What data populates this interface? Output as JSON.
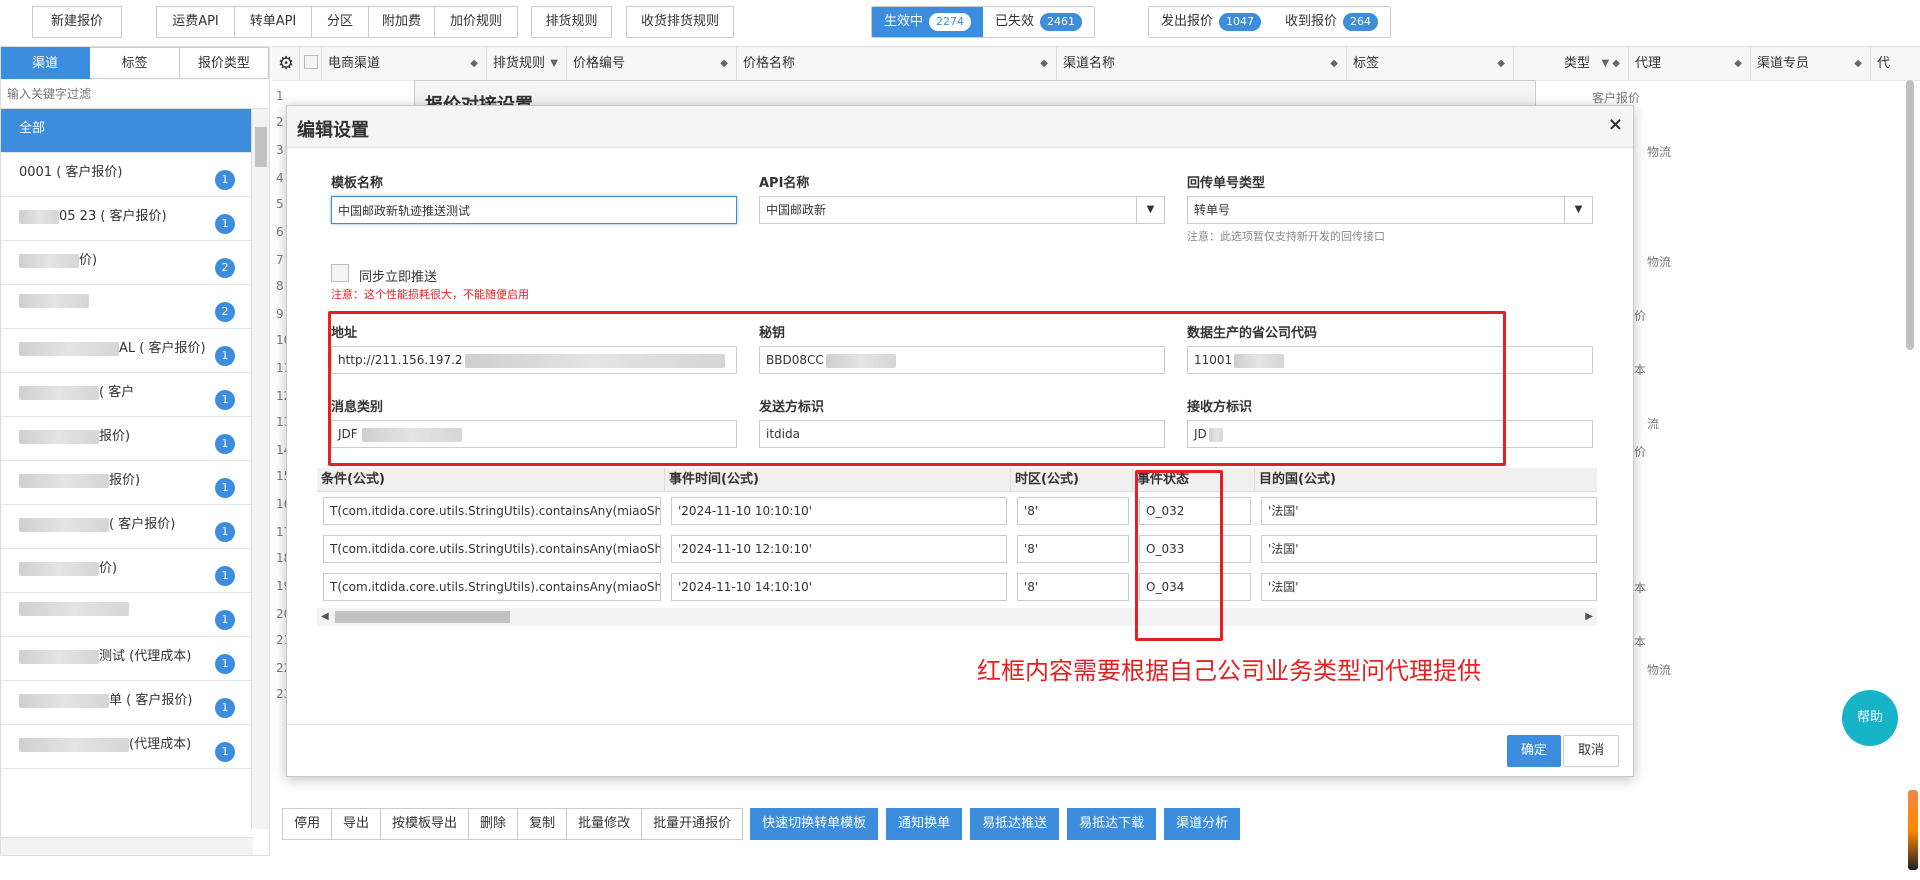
{
  "toolbar": {
    "new_quote": "新建报价",
    "tabs": [
      "运费API",
      "转单API",
      "分区",
      "附加费",
      "加价规则"
    ],
    "dispatch_rules": "排货规则",
    "receive_rules": "收货排货规则",
    "status_seg": [
      {
        "label": "生效中",
        "count": "2274"
      },
      {
        "label": "已失效",
        "count": "2461"
      }
    ],
    "quote_seg": [
      {
        "label": "发出报价",
        "count": "1047"
      },
      {
        "label": "收到报价",
        "count": "264"
      }
    ]
  },
  "left": {
    "tabs": [
      "渠道",
      "标签",
      "报价类型"
    ],
    "filter_placeholder": "输入关键字过滤",
    "items": [
      {
        "label": "全部",
        "count": ""
      },
      {
        "label": "0001 ( 客户报价)",
        "count": "1"
      },
      {
        "label": "05    23 ( 客户报价)",
        "count": "1"
      },
      {
        "label": "价)",
        "count": "2"
      },
      {
        "label": "",
        "count": "2"
      },
      {
        "label": "AL  ( 客户报价)",
        "count": "1"
      },
      {
        "label": "( 客户",
        "count": "1"
      },
      {
        "label": "报价)",
        "count": "1"
      },
      {
        "label": "报价)",
        "count": "1"
      },
      {
        "label": "( 客户报价)",
        "count": "1"
      },
      {
        "label": "价)",
        "count": "1"
      },
      {
        "label": "",
        "count": "1"
      },
      {
        "label": "测试 (代理成本)",
        "count": "1"
      },
      {
        "label": "单 ( 客户报价)",
        "count": "1"
      },
      {
        "label": "(代理成本)",
        "count": "1"
      }
    ]
  },
  "grid": {
    "columns": [
      "电商渠道",
      "排货规则",
      "价格编号",
      "价格名称",
      "渠道名称",
      "标签",
      "类型",
      "代理",
      "渠道专员",
      "代"
    ],
    "rows": [
      "1",
      "2",
      "3",
      "4",
      "5",
      "6",
      "7",
      "8",
      "9",
      "10",
      "11",
      "12",
      "13",
      "14",
      "15",
      "16",
      "17",
      "18",
      "19",
      "20",
      "21",
      "22",
      "23"
    ],
    "right_texts": [
      "客户报价",
      "物流",
      "物流",
      "价",
      "本",
      "流",
      "价",
      "本",
      "本",
      "物流"
    ]
  },
  "bg_dialog": {
    "title": "报价对接设置"
  },
  "dialog": {
    "title": "编辑设置",
    "template_name_label": "模板名称",
    "template_name_value": "中国邮政新轨迹推送测试",
    "api_name_label": "API名称",
    "api_name_value": "中国邮政新",
    "return_type_label": "回传单号类型",
    "return_type_value": "转单号",
    "return_type_note": "注意：此选项暂仅支持新开发的回传接口",
    "sync_label": "同步立即推送",
    "sync_note": "注意：这个性能损耗很大，不能随便启用",
    "address_label": "地址",
    "address_value": "http://211.156.197.2",
    "secret_label": "秘钥",
    "secret_value": "BBD08CC",
    "province_code_label": "数据生产的省公司代码",
    "province_code_value": "11001",
    "msg_type_label": "消息类别",
    "msg_type_value": "JDF",
    "sender_label": "发送方标识",
    "sender_value": "itdida",
    "receiver_label": "接收方标识",
    "receiver_value": "JD",
    "table_headers": [
      "条件(公式)",
      "事件时间(公式)",
      "时区(公式)",
      "事件状态",
      "目的国(公式)"
    ],
    "table_rows": [
      {
        "cond": "T(com.itdida.core.utils.StringUtils).containsAny(miaoSh",
        "time": "'2024-11-10 10:10:10'",
        "tz": "'8'",
        "status": "O_032",
        "dest": "'法国'"
      },
      {
        "cond": "T(com.itdida.core.utils.StringUtils).containsAny(miaoSh",
        "time": "'2024-11-10 12:10:10'",
        "tz": "'8'",
        "status": "O_033",
        "dest": "'法国'"
      },
      {
        "cond": "T(com.itdida.core.utils.StringUtils).containsAny(miaoSh",
        "time": "'2024-11-10 14:10:10'",
        "tz": "'8'",
        "status": "O_034",
        "dest": "'法国'"
      }
    ],
    "annotation": "红框内容需要根据自己公司业务类型问代理提供",
    "ok": "确定",
    "cancel": "取消",
    "close": "×"
  },
  "bottom": {
    "plain": [
      "停用",
      "导出",
      "按模板导出",
      "删除",
      "复制",
      "批量修改",
      "批量开通报价"
    ],
    "blue": [
      "快速切换转单模板",
      "通知换单",
      "易抵达推送",
      "易抵达下载",
      "渠道分析"
    ]
  },
  "help": "帮助",
  "colors": {
    "primary": "#3c8dde",
    "annotation": "#e62020",
    "help": "#17b3c8"
  }
}
